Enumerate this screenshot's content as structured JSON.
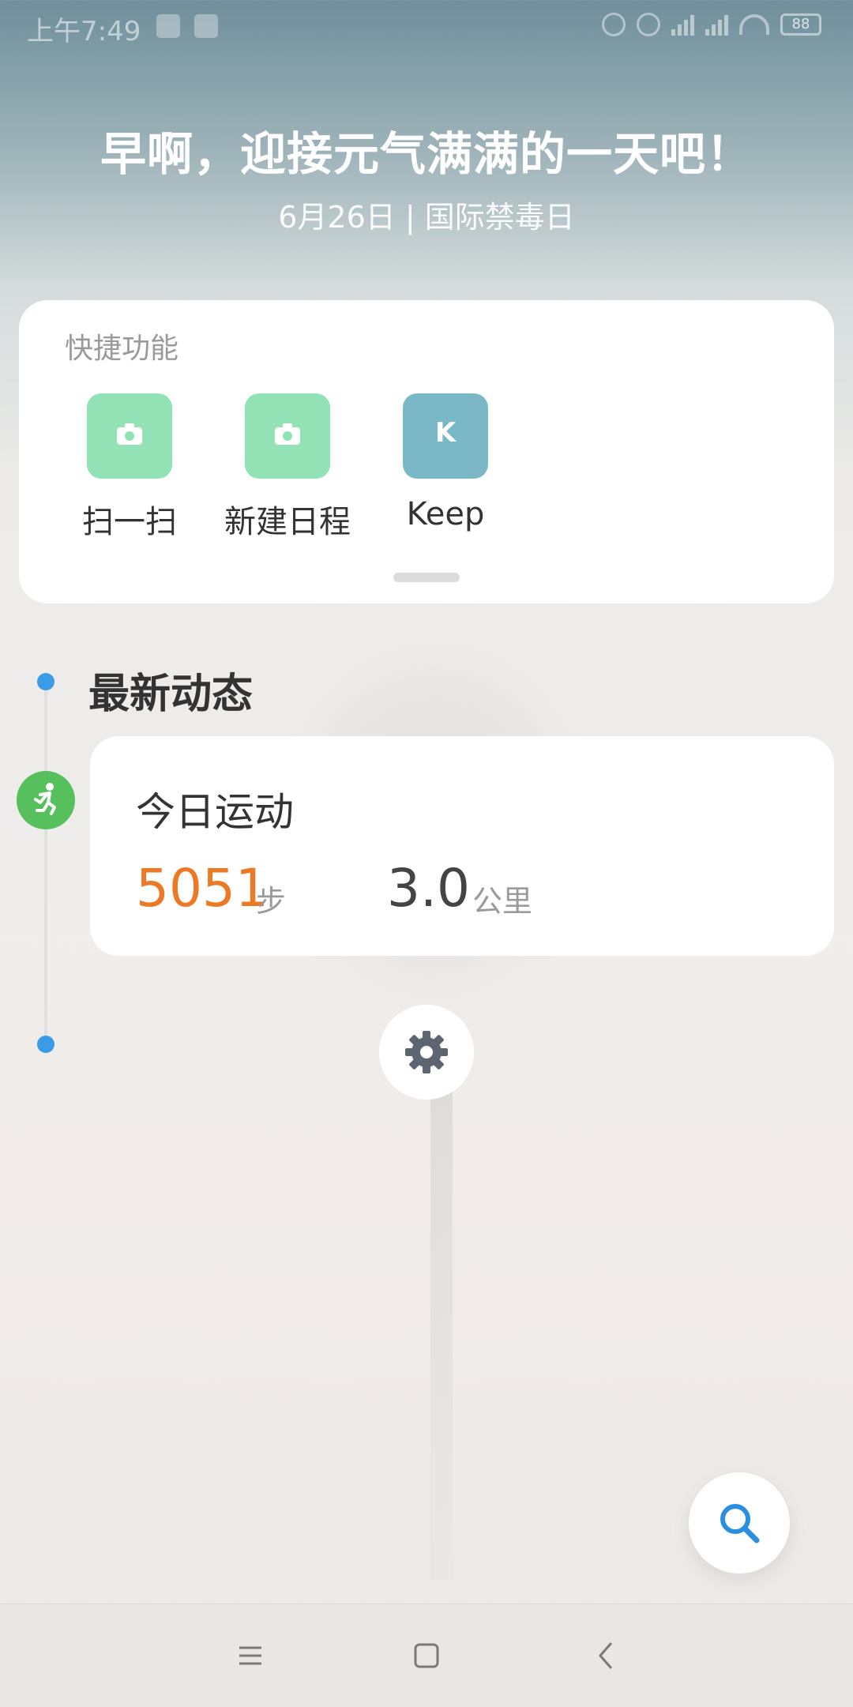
{
  "status_bar": {
    "time": "上午7:49",
    "battery": "88"
  },
  "greeting": {
    "title": "早啊，迎接元气满满的一天吧！",
    "subtitle": "6月26日 | 国际禁毒日"
  },
  "quick_functions": {
    "title": "快捷功能",
    "items": [
      {
        "label": "扫一扫",
        "icon": "camera-icon",
        "color": "#92e2b5"
      },
      {
        "label": "新建日程",
        "icon": "camera-icon",
        "color": "#92e2b5"
      },
      {
        "label": "Keep",
        "icon": "keep-icon",
        "color": "#7ab8c7",
        "glyph": "K"
      }
    ]
  },
  "feed": {
    "title": "最新动态",
    "activity": {
      "title": "今日运动",
      "steps_value": "5051",
      "steps_unit": "步",
      "distance_value": "3.0",
      "distance_unit": "公里"
    }
  },
  "colors": {
    "accent_blue": "#3a9be6",
    "steps_orange": "#ec7a24",
    "run_green": "#56c05c"
  }
}
